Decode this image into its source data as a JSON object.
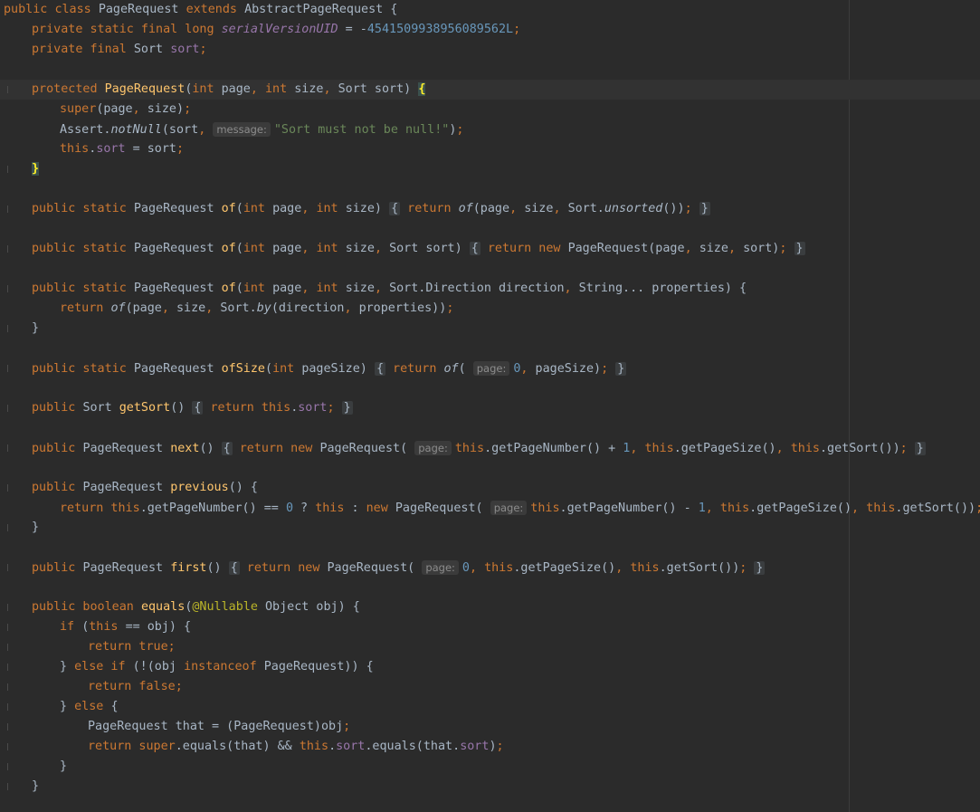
{
  "editor": {
    "language": "java",
    "lines": [
      {
        "indent": 0,
        "tokens": [
          [
            "kw",
            "public "
          ],
          [
            "kw",
            "class "
          ],
          [
            "plain",
            "PageRequest "
          ],
          [
            "kw",
            "extends "
          ],
          [
            "plain",
            "AbstractPageRequest {"
          ]
        ]
      },
      {
        "indent": 1,
        "tokens": [
          [
            "kw",
            "private static final long "
          ],
          [
            "static-field",
            "serialVersionUID"
          ],
          [
            "plain",
            " = -"
          ],
          [
            "num",
            "4541509938956089562L"
          ],
          [
            "kw",
            ";"
          ]
        ]
      },
      {
        "indent": 1,
        "tokens": [
          [
            "kw",
            "private final "
          ],
          [
            "plain",
            "Sort "
          ],
          [
            "fld",
            "sort"
          ],
          [
            "kw",
            ";"
          ]
        ]
      },
      {
        "indent": 0,
        "tokens": []
      },
      {
        "indent": 1,
        "current": true,
        "tokens": [
          [
            "kw",
            "protected "
          ],
          [
            "fn",
            "PageRequest"
          ],
          [
            "plain",
            "("
          ],
          [
            "kw",
            "int "
          ],
          [
            "plain",
            "page"
          ],
          [
            "kw",
            ", "
          ],
          [
            "kw",
            "int "
          ],
          [
            "plain",
            "size"
          ],
          [
            "kw",
            ", "
          ],
          [
            "plain",
            "Sort sort) "
          ],
          [
            "brace-hl",
            "{"
          ]
        ]
      },
      {
        "indent": 2,
        "tokens": [
          [
            "kw",
            "super"
          ],
          [
            "plain",
            "(page"
          ],
          [
            "kw",
            ", "
          ],
          [
            "plain",
            "size)"
          ],
          [
            "kw",
            ";"
          ]
        ]
      },
      {
        "indent": 2,
        "tokens": [
          [
            "plain",
            "Assert."
          ],
          [
            "ital",
            "notNull"
          ],
          [
            "plain",
            "(sort"
          ],
          [
            "kw",
            ", "
          ],
          [
            "hint",
            "message:"
          ],
          [
            "str",
            "\"Sort must not be null!\""
          ],
          [
            "plain",
            ")"
          ],
          [
            "kw",
            ";"
          ]
        ]
      },
      {
        "indent": 2,
        "tokens": [
          [
            "kw",
            "this"
          ],
          [
            "plain",
            "."
          ],
          [
            "fld",
            "sort"
          ],
          [
            "plain",
            " = sort"
          ],
          [
            "kw",
            ";"
          ]
        ]
      },
      {
        "indent": 1,
        "tokens": [
          [
            "brace-hl",
            "}"
          ]
        ]
      },
      {
        "indent": 0,
        "tokens": []
      },
      {
        "indent": 1,
        "tokens": [
          [
            "kw",
            "public static "
          ],
          [
            "plain",
            "PageRequest "
          ],
          [
            "fn",
            "of"
          ],
          [
            "plain",
            "("
          ],
          [
            "kw",
            "int "
          ],
          [
            "plain",
            "page"
          ],
          [
            "kw",
            ", "
          ],
          [
            "kw",
            "int "
          ],
          [
            "plain",
            "size) "
          ],
          [
            "fold",
            "{"
          ],
          [
            "kw",
            " return "
          ],
          [
            "ital",
            "of"
          ],
          [
            "plain",
            "(page"
          ],
          [
            "kw",
            ", "
          ],
          [
            "plain",
            "size"
          ],
          [
            "kw",
            ", "
          ],
          [
            "plain",
            "Sort."
          ],
          [
            "ital",
            "unsorted"
          ],
          [
            "plain",
            "())"
          ],
          [
            "kw",
            "; "
          ],
          [
            "fold",
            "}"
          ]
        ]
      },
      {
        "indent": 0,
        "tokens": []
      },
      {
        "indent": 1,
        "tokens": [
          [
            "kw",
            "public static "
          ],
          [
            "plain",
            "PageRequest "
          ],
          [
            "fn",
            "of"
          ],
          [
            "plain",
            "("
          ],
          [
            "kw",
            "int "
          ],
          [
            "plain",
            "page"
          ],
          [
            "kw",
            ", "
          ],
          [
            "kw",
            "int "
          ],
          [
            "plain",
            "size"
          ],
          [
            "kw",
            ", "
          ],
          [
            "plain",
            "Sort sort) "
          ],
          [
            "fold",
            "{"
          ],
          [
            "kw",
            " return new "
          ],
          [
            "plain",
            "PageRequest(page"
          ],
          [
            "kw",
            ", "
          ],
          [
            "plain",
            "size"
          ],
          [
            "kw",
            ", "
          ],
          [
            "plain",
            "sort)"
          ],
          [
            "kw",
            "; "
          ],
          [
            "fold",
            "}"
          ]
        ]
      },
      {
        "indent": 0,
        "tokens": []
      },
      {
        "indent": 1,
        "tokens": [
          [
            "kw",
            "public static "
          ],
          [
            "plain",
            "PageRequest "
          ],
          [
            "fn",
            "of"
          ],
          [
            "plain",
            "("
          ],
          [
            "kw",
            "int "
          ],
          [
            "plain",
            "page"
          ],
          [
            "kw",
            ", "
          ],
          [
            "kw",
            "int "
          ],
          [
            "plain",
            "size"
          ],
          [
            "kw",
            ", "
          ],
          [
            "plain",
            "Sort.Direction direction"
          ],
          [
            "kw",
            ", "
          ],
          [
            "plain",
            "String... properties) {"
          ]
        ]
      },
      {
        "indent": 2,
        "tokens": [
          [
            "kw",
            "return "
          ],
          [
            "ital",
            "of"
          ],
          [
            "plain",
            "(page"
          ],
          [
            "kw",
            ", "
          ],
          [
            "plain",
            "size"
          ],
          [
            "kw",
            ", "
          ],
          [
            "plain",
            "Sort."
          ],
          [
            "ital",
            "by"
          ],
          [
            "plain",
            "(direction"
          ],
          [
            "kw",
            ", "
          ],
          [
            "plain",
            "properties))"
          ],
          [
            "kw",
            ";"
          ]
        ]
      },
      {
        "indent": 1,
        "tokens": [
          [
            "plain",
            "}"
          ]
        ]
      },
      {
        "indent": 0,
        "tokens": []
      },
      {
        "indent": 1,
        "tokens": [
          [
            "kw",
            "public static "
          ],
          [
            "plain",
            "PageRequest "
          ],
          [
            "fn",
            "ofSize"
          ],
          [
            "plain",
            "("
          ],
          [
            "kw",
            "int "
          ],
          [
            "plain",
            "pageSize) "
          ],
          [
            "fold",
            "{"
          ],
          [
            "kw",
            " return "
          ],
          [
            "ital",
            "of"
          ],
          [
            "plain",
            "( "
          ],
          [
            "hint",
            "page:"
          ],
          [
            "num",
            "0"
          ],
          [
            "kw",
            ", "
          ],
          [
            "plain",
            "pageSize)"
          ],
          [
            "kw",
            "; "
          ],
          [
            "fold",
            "}"
          ]
        ]
      },
      {
        "indent": 0,
        "tokens": []
      },
      {
        "indent": 1,
        "tokens": [
          [
            "kw",
            "public "
          ],
          [
            "plain",
            "Sort "
          ],
          [
            "fn",
            "getSort"
          ],
          [
            "plain",
            "() "
          ],
          [
            "fold",
            "{"
          ],
          [
            "kw",
            " return this"
          ],
          [
            "plain",
            "."
          ],
          [
            "fld",
            "sort"
          ],
          [
            "kw",
            "; "
          ],
          [
            "fold",
            "}"
          ]
        ]
      },
      {
        "indent": 0,
        "tokens": []
      },
      {
        "indent": 1,
        "tokens": [
          [
            "kw",
            "public "
          ],
          [
            "plain",
            "PageRequest "
          ],
          [
            "fn",
            "next"
          ],
          [
            "plain",
            "() "
          ],
          [
            "fold",
            "{"
          ],
          [
            "kw",
            " return new "
          ],
          [
            "plain",
            "PageRequest( "
          ],
          [
            "hint",
            "page:"
          ],
          [
            "kw",
            "this"
          ],
          [
            "plain",
            ".getPageNumber() + "
          ],
          [
            "num",
            "1"
          ],
          [
            "kw",
            ", "
          ],
          [
            "kw",
            "this"
          ],
          [
            "plain",
            ".getPageSize()"
          ],
          [
            "kw",
            ", "
          ],
          [
            "kw",
            "this"
          ],
          [
            "plain",
            ".getSort())"
          ],
          [
            "kw",
            "; "
          ],
          [
            "fold",
            "}"
          ]
        ]
      },
      {
        "indent": 0,
        "tokens": []
      },
      {
        "indent": 1,
        "tokens": [
          [
            "kw",
            "public "
          ],
          [
            "plain",
            "PageRequest "
          ],
          [
            "fn",
            "previous"
          ],
          [
            "plain",
            "() {"
          ]
        ]
      },
      {
        "indent": 2,
        "tokens": [
          [
            "kw",
            "return this"
          ],
          [
            "plain",
            ".getPageNumber() == "
          ],
          [
            "num",
            "0"
          ],
          [
            "plain",
            " ? "
          ],
          [
            "kw",
            "this"
          ],
          [
            "plain",
            " : "
          ],
          [
            "kw",
            "new "
          ],
          [
            "plain",
            "PageRequest( "
          ],
          [
            "hint",
            "page:"
          ],
          [
            "kw",
            "this"
          ],
          [
            "plain",
            ".getPageNumber() - "
          ],
          [
            "num",
            "1"
          ],
          [
            "kw",
            ", "
          ],
          [
            "kw",
            "this"
          ],
          [
            "plain",
            ".getPageSize()"
          ],
          [
            "kw",
            ", "
          ],
          [
            "kw",
            "this"
          ],
          [
            "plain",
            ".getSort())"
          ],
          [
            "kw",
            ";"
          ]
        ]
      },
      {
        "indent": 1,
        "tokens": [
          [
            "plain",
            "}"
          ]
        ]
      },
      {
        "indent": 0,
        "tokens": []
      },
      {
        "indent": 1,
        "tokens": [
          [
            "kw",
            "public "
          ],
          [
            "plain",
            "PageRequest "
          ],
          [
            "fn",
            "first"
          ],
          [
            "plain",
            "() "
          ],
          [
            "fold",
            "{"
          ],
          [
            "kw",
            " return new "
          ],
          [
            "plain",
            "PageRequest( "
          ],
          [
            "hint",
            "page:"
          ],
          [
            "num",
            "0"
          ],
          [
            "kw",
            ", "
          ],
          [
            "kw",
            "this"
          ],
          [
            "plain",
            ".getPageSize()"
          ],
          [
            "kw",
            ", "
          ],
          [
            "kw",
            "this"
          ],
          [
            "plain",
            ".getSort())"
          ],
          [
            "kw",
            "; "
          ],
          [
            "fold",
            "}"
          ]
        ]
      },
      {
        "indent": 0,
        "tokens": []
      },
      {
        "indent": 1,
        "tokens": [
          [
            "kw",
            "public boolean "
          ],
          [
            "fn",
            "equals"
          ],
          [
            "plain",
            "("
          ],
          [
            "ann",
            "@Nullable "
          ],
          [
            "plain",
            "Object obj) {"
          ]
        ]
      },
      {
        "indent": 2,
        "tokens": [
          [
            "kw",
            "if "
          ],
          [
            "plain",
            "("
          ],
          [
            "kw",
            "this "
          ],
          [
            "plain",
            "== obj) {"
          ]
        ]
      },
      {
        "indent": 3,
        "tokens": [
          [
            "kw",
            "return true;"
          ]
        ]
      },
      {
        "indent": 2,
        "tokens": [
          [
            "plain",
            "} "
          ],
          [
            "kw",
            "else if "
          ],
          [
            "plain",
            "(!(obj "
          ],
          [
            "kw",
            "instanceof "
          ],
          [
            "plain",
            "PageRequest)) {"
          ]
        ]
      },
      {
        "indent": 3,
        "tokens": [
          [
            "kw",
            "return false;"
          ]
        ]
      },
      {
        "indent": 2,
        "tokens": [
          [
            "plain",
            "} "
          ],
          [
            "kw",
            "else "
          ],
          [
            "plain",
            "{"
          ]
        ]
      },
      {
        "indent": 3,
        "tokens": [
          [
            "plain",
            "PageRequest that = (PageRequest)obj"
          ],
          [
            "kw",
            ";"
          ]
        ]
      },
      {
        "indent": 3,
        "tokens": [
          [
            "kw",
            "return super"
          ],
          [
            "plain",
            ".equals(that) && "
          ],
          [
            "kw",
            "this"
          ],
          [
            "plain",
            "."
          ],
          [
            "fld",
            "sort"
          ],
          [
            "plain",
            ".equals(that."
          ],
          [
            "fld",
            "sort"
          ],
          [
            "plain",
            ")"
          ],
          [
            "kw",
            ";"
          ]
        ]
      },
      {
        "indent": 2,
        "tokens": [
          [
            "plain",
            "}"
          ]
        ]
      },
      {
        "indent": 1,
        "tokens": [
          [
            "plain",
            "}"
          ]
        ]
      }
    ],
    "gutter_marks": [
      4,
      8,
      10,
      12,
      14,
      16,
      18,
      20,
      22,
      24,
      26,
      28,
      30,
      31,
      32,
      33,
      34,
      35,
      36,
      37,
      38,
      39
    ],
    "colors": {
      "background": "#2b2b2b",
      "keyword": "#cc7832",
      "method": "#ffc66d",
      "number": "#6897bb",
      "string": "#6a8759",
      "field": "#9876aa",
      "annotation": "#bbb529",
      "text": "#a9b7c6"
    },
    "icons": [
      "intention-bulb-icon"
    ]
  }
}
